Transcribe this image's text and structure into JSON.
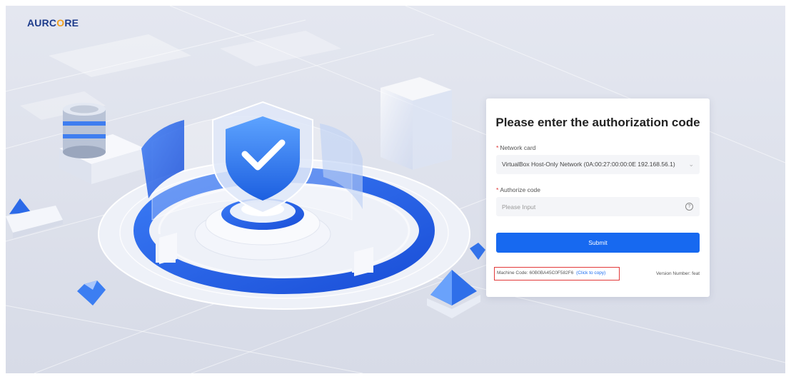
{
  "brand": {
    "logo_left": "AURC",
    "logo_ring": "O",
    "logo_right": "RE",
    "color": "#1e3c8c",
    "accent": "#f0a020"
  },
  "form": {
    "title": "Please enter the authorization code",
    "network_card_label": "Network card",
    "network_card_value": "VirtualBox Host-Only Network (0A:00:27:00:00:0E 192.168.56.1)",
    "authorize_label": "Authorize code",
    "authorize_placeholder": "Please Input",
    "submit_label": "Submit",
    "required_mark": "*"
  },
  "footer": {
    "machine_code_text": "Machine Code: 60B0BA45C0F582F6",
    "copy_link": "(Click to copy)",
    "version_text": "Version Number: feat"
  },
  "colors": {
    "primary": "#1769f0",
    "highlight_border": "#e23a3a"
  }
}
